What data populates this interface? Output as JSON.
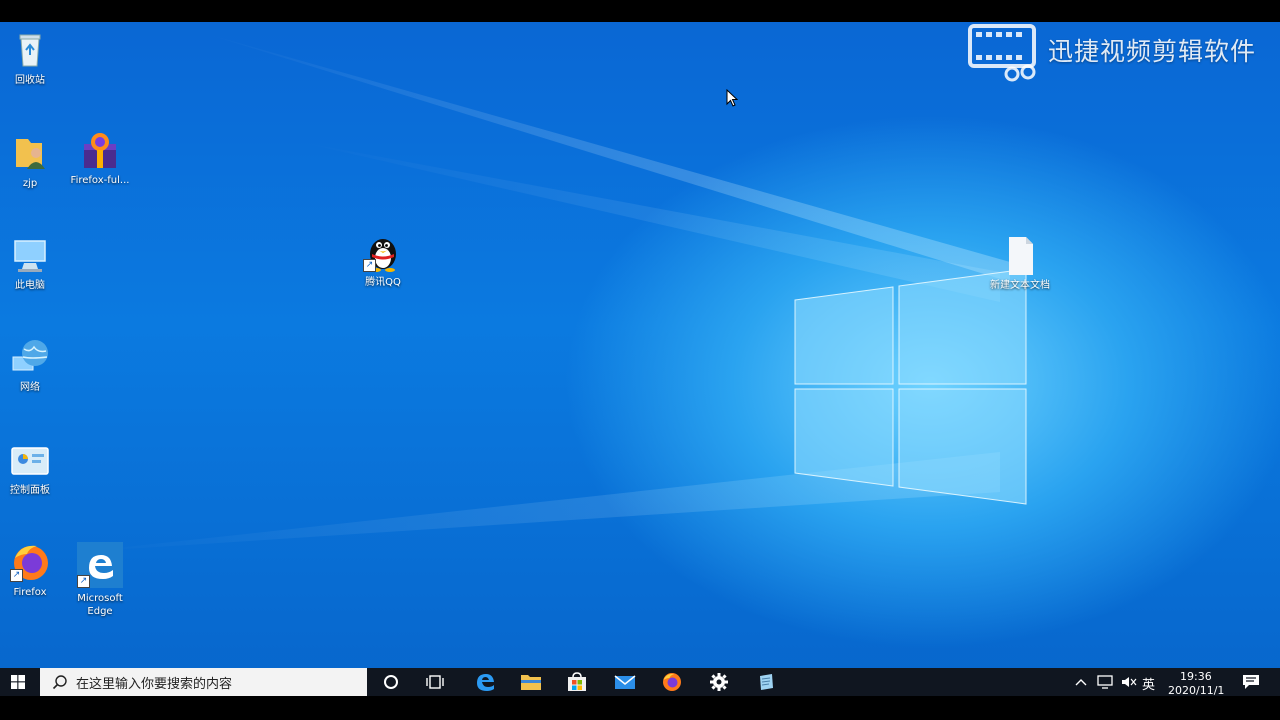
{
  "desktop": {
    "icons": [
      {
        "label": "回收站"
      },
      {
        "label": "zjp"
      },
      {
        "label": "Firefox-ful..."
      },
      {
        "label": "此电脑"
      },
      {
        "label": "腾讯QQ"
      },
      {
        "label": "新建文本文档"
      },
      {
        "label": "网络"
      },
      {
        "label": "控制面板"
      },
      {
        "label": "Firefox"
      },
      {
        "label": "Microsoft Edge"
      }
    ]
  },
  "watermark": {
    "text": "迅捷视频剪辑软件"
  },
  "taskbar": {
    "search_placeholder": "在这里输入你要搜索的内容",
    "pinned": [
      "cortana-icon",
      "task-view-icon",
      "edge-icon",
      "file-explorer-icon",
      "store-icon",
      "mail-icon",
      "firefox-icon",
      "settings-icon",
      "notepad-icon"
    ],
    "tray": {
      "ime": "英",
      "time": "19:36",
      "date": "2020/11/1"
    }
  },
  "colors": {
    "accent": "#0a78dc",
    "taskbar": "#101620"
  }
}
